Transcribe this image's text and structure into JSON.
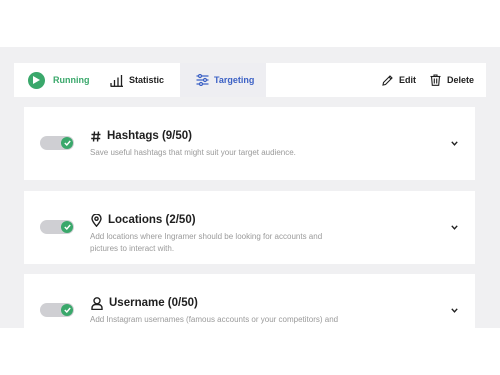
{
  "colors": {
    "accent_green": "#3aa86b",
    "accent_blue": "#3c61c5",
    "background": "#f0f0f2",
    "text_primary": "#202020",
    "text_muted": "#9a9a9a"
  },
  "toolbar": {
    "tabs": [
      {
        "label": "Running",
        "icon": "play-icon",
        "active": false
      },
      {
        "label": "Statistic",
        "icon": "bar-chart-icon",
        "active": false
      },
      {
        "label": "Targeting",
        "icon": "sliders-icon",
        "active": true
      }
    ],
    "edit_label": "Edit",
    "edit_icon": "pencil-icon",
    "delete_label": "Delete",
    "delete_icon": "trash-icon"
  },
  "sections": [
    {
      "icon": "hashtag-icon",
      "title": "Hashtags (9/50)",
      "description_lines": [
        "Save useful hashtags that might suit your target audience."
      ],
      "enabled": true
    },
    {
      "icon": "location-pin-icon",
      "title": "Locations (2/50)",
      "description_lines": [
        "Add locations where Ingramer should be looking for accounts and",
        "pictures to interact with."
      ],
      "enabled": true
    },
    {
      "icon": "user-icon",
      "title": "Username (0/50)",
      "description_lines": [
        "Add Instagram usernames (famous accounts or your competitors) and"
      ],
      "enabled": true
    }
  ]
}
